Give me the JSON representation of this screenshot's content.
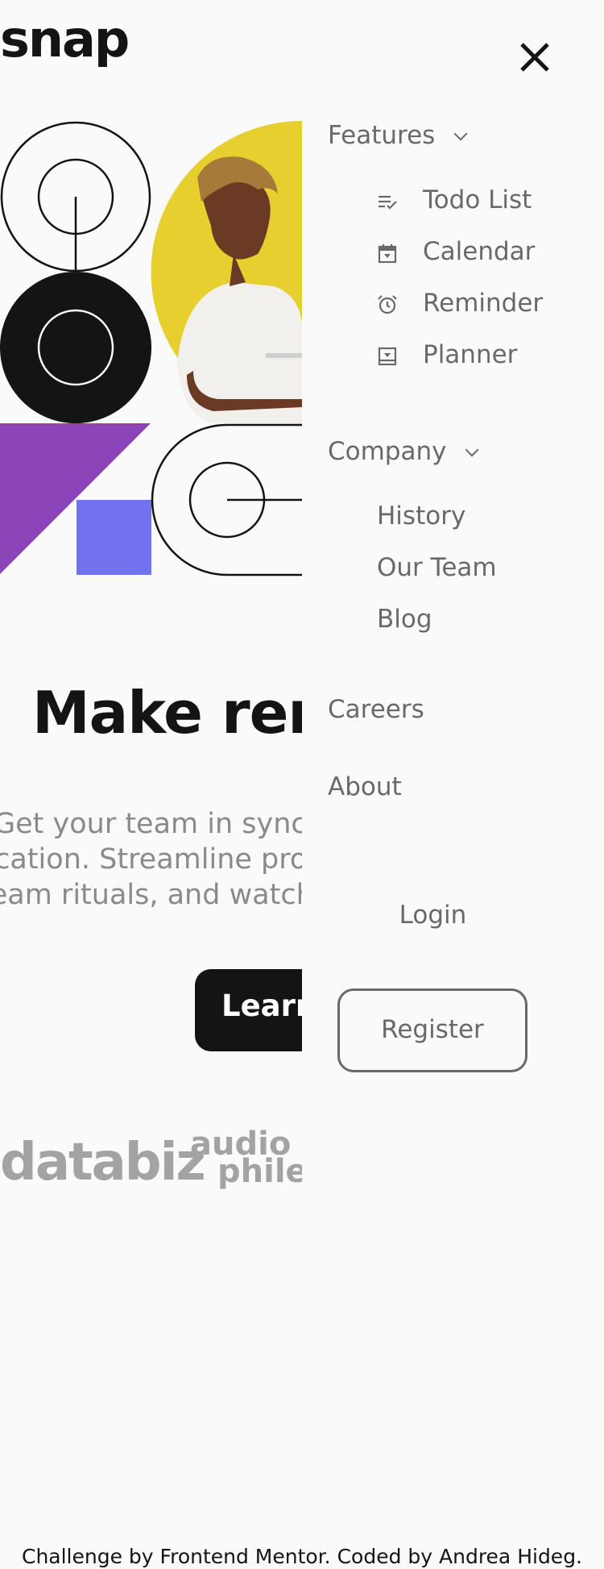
{
  "brand": {
    "logo": "snap"
  },
  "hero": {
    "title": "Make remote work",
    "text_lines": [
      "Get your team in sync, no matter your",
      "location. Streamline processes, create",
      "team rituals, and watch productivity soar."
    ],
    "cta_label": "Learn more",
    "colors": {
      "yellow": "#e6cf2e",
      "black": "#141414",
      "purple": "#8b45b8",
      "blue": "#7272ef"
    }
  },
  "clients": {
    "databiz": "databiz",
    "audiophile": [
      "audio",
      "phile"
    ]
  },
  "menu": {
    "close_icon": "close-icon",
    "features": {
      "label": "Features",
      "items": [
        {
          "label": "Todo List",
          "icon": "todo-icon"
        },
        {
          "label": "Calendar",
          "icon": "calendar-icon"
        },
        {
          "label": "Reminder",
          "icon": "reminder-icon"
        },
        {
          "label": "Planner",
          "icon": "planner-icon"
        }
      ]
    },
    "company": {
      "label": "Company",
      "items": [
        {
          "label": "History"
        },
        {
          "label": "Our Team"
        },
        {
          "label": "Blog"
        }
      ]
    },
    "careers": "Careers",
    "about": "About",
    "login": "Login",
    "register": "Register"
  },
  "footer": {
    "credit": "Challenge by Frontend Mentor. Coded by Andrea Hideg."
  }
}
